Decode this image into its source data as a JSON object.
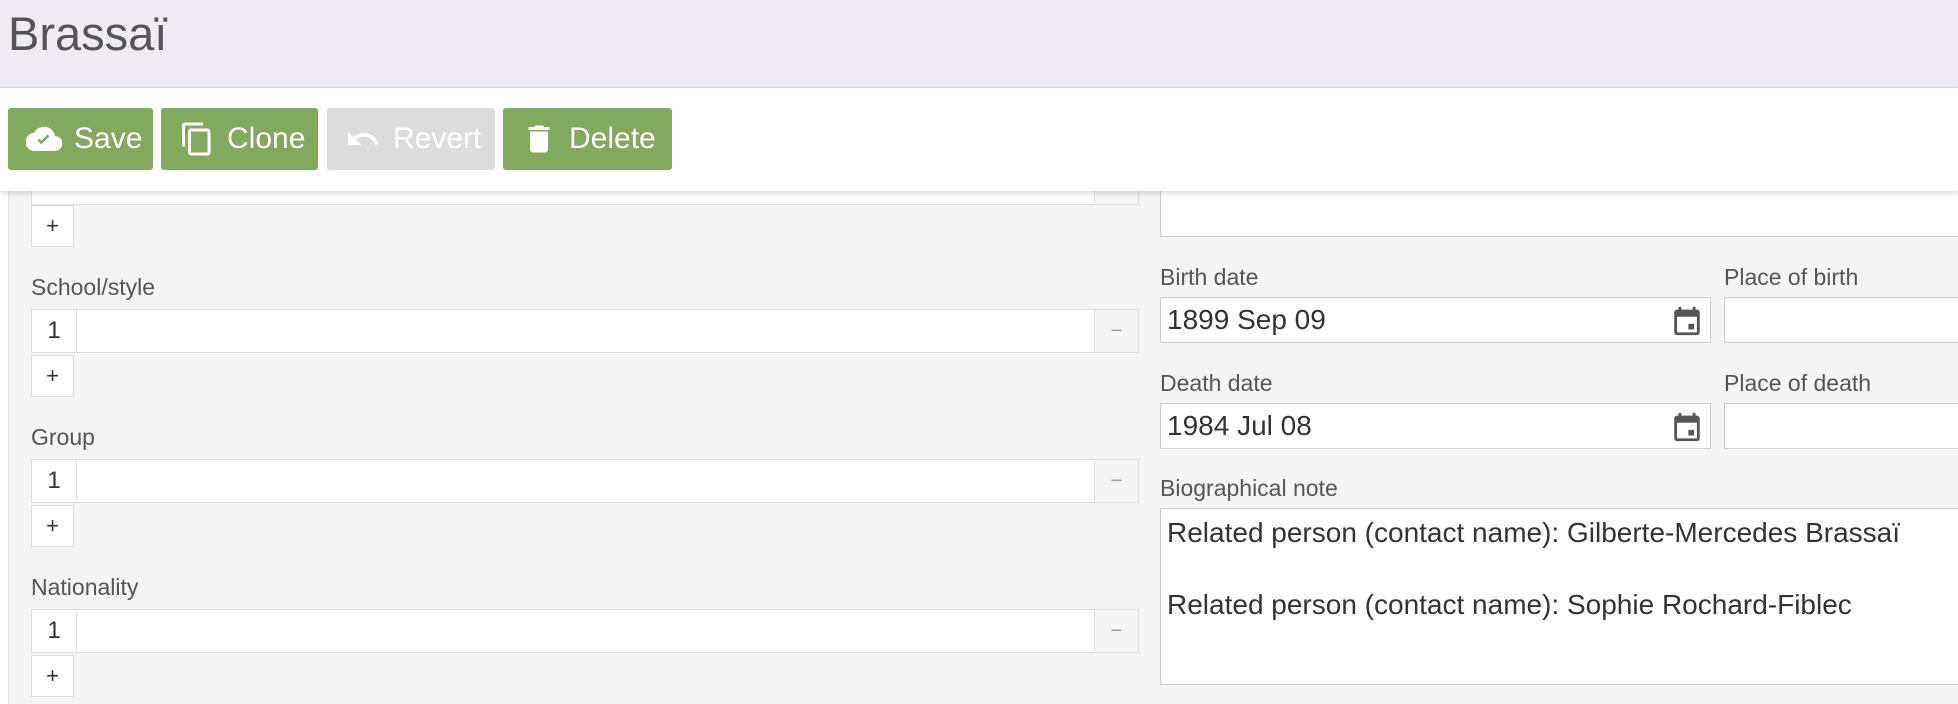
{
  "header": {
    "title": "Brassaï"
  },
  "toolbar": {
    "save_label": "Save",
    "clone_label": "Clone",
    "revert_label": "Revert",
    "delete_label": "Delete"
  },
  "left": {
    "plus_label": "+",
    "minus_label": "−",
    "school_style": {
      "label": "School/style",
      "rows": [
        {
          "num": "1",
          "value": ""
        }
      ]
    },
    "group": {
      "label": "Group",
      "rows": [
        {
          "num": "1",
          "value": ""
        }
      ]
    },
    "nationality": {
      "label": "Nationality",
      "rows": [
        {
          "num": "1",
          "value": ""
        }
      ]
    }
  },
  "right": {
    "birth_date": {
      "label": "Birth date",
      "value": "1899 Sep 09"
    },
    "place_of_birth": {
      "label": "Place of birth",
      "value": ""
    },
    "death_date": {
      "label": "Death date",
      "value": "1984 Jul 08"
    },
    "place_of_death": {
      "label": "Place of death",
      "value": ""
    },
    "bio_note": {
      "label": "Biographical note",
      "lines": [
        "Related person (contact name): Gilberte-Mercedes Brassaï",
        "Related person (contact name): Sophie Rochard-Fiblec"
      ]
    }
  },
  "colors": {
    "accent_green": "#82a95e",
    "header_bg": "#f0ebf3",
    "disabled": "#dcdcdc"
  },
  "icons": [
    "cloud-upload-icon",
    "copy-icon",
    "undo-icon",
    "trash-icon",
    "calendar-icon"
  ]
}
